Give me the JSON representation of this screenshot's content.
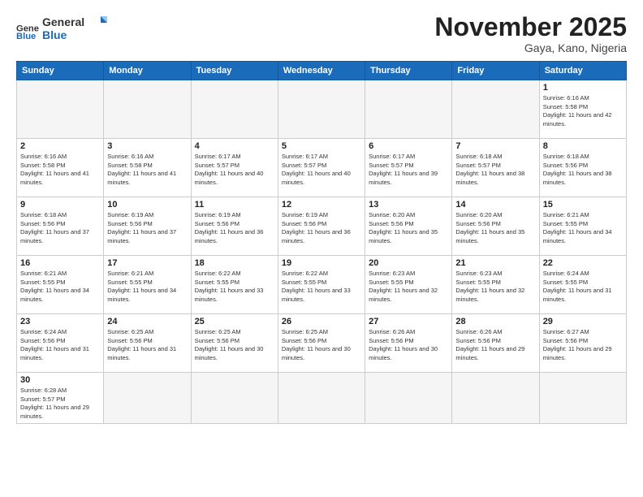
{
  "logo": {
    "text_general": "General",
    "text_blue": "Blue"
  },
  "title": "November 2025",
  "location": "Gaya, Kano, Nigeria",
  "weekdays": [
    "Sunday",
    "Monday",
    "Tuesday",
    "Wednesday",
    "Thursday",
    "Friday",
    "Saturday"
  ],
  "weeks": [
    [
      {
        "day": "",
        "empty": true
      },
      {
        "day": "",
        "empty": true
      },
      {
        "day": "",
        "empty": true
      },
      {
        "day": "",
        "empty": true
      },
      {
        "day": "",
        "empty": true
      },
      {
        "day": "",
        "empty": true
      },
      {
        "day": "1",
        "sunrise": "6:16 AM",
        "sunset": "5:58 PM",
        "daylight": "11 hours and 42 minutes."
      }
    ],
    [
      {
        "day": "2",
        "sunrise": "6:16 AM",
        "sunset": "5:58 PM",
        "daylight": "11 hours and 41 minutes."
      },
      {
        "day": "3",
        "sunrise": "6:16 AM",
        "sunset": "5:58 PM",
        "daylight": "11 hours and 41 minutes."
      },
      {
        "day": "4",
        "sunrise": "6:17 AM",
        "sunset": "5:57 PM",
        "daylight": "11 hours and 40 minutes."
      },
      {
        "day": "5",
        "sunrise": "6:17 AM",
        "sunset": "5:57 PM",
        "daylight": "11 hours and 40 minutes."
      },
      {
        "day": "6",
        "sunrise": "6:17 AM",
        "sunset": "5:57 PM",
        "daylight": "11 hours and 39 minutes."
      },
      {
        "day": "7",
        "sunrise": "6:18 AM",
        "sunset": "5:57 PM",
        "daylight": "11 hours and 38 minutes."
      },
      {
        "day": "8",
        "sunrise": "6:18 AM",
        "sunset": "5:56 PM",
        "daylight": "11 hours and 38 minutes."
      }
    ],
    [
      {
        "day": "9",
        "sunrise": "6:18 AM",
        "sunset": "5:56 PM",
        "daylight": "11 hours and 37 minutes."
      },
      {
        "day": "10",
        "sunrise": "6:19 AM",
        "sunset": "5:56 PM",
        "daylight": "11 hours and 37 minutes."
      },
      {
        "day": "11",
        "sunrise": "6:19 AM",
        "sunset": "5:56 PM",
        "daylight": "11 hours and 36 minutes."
      },
      {
        "day": "12",
        "sunrise": "6:19 AM",
        "sunset": "5:56 PM",
        "daylight": "11 hours and 36 minutes."
      },
      {
        "day": "13",
        "sunrise": "6:20 AM",
        "sunset": "5:56 PM",
        "daylight": "11 hours and 35 minutes."
      },
      {
        "day": "14",
        "sunrise": "6:20 AM",
        "sunset": "5:56 PM",
        "daylight": "11 hours and 35 minutes."
      },
      {
        "day": "15",
        "sunrise": "6:21 AM",
        "sunset": "5:55 PM",
        "daylight": "11 hours and 34 minutes."
      }
    ],
    [
      {
        "day": "16",
        "sunrise": "6:21 AM",
        "sunset": "5:55 PM",
        "daylight": "11 hours and 34 minutes."
      },
      {
        "day": "17",
        "sunrise": "6:21 AM",
        "sunset": "5:55 PM",
        "daylight": "11 hours and 34 minutes."
      },
      {
        "day": "18",
        "sunrise": "6:22 AM",
        "sunset": "5:55 PM",
        "daylight": "11 hours and 33 minutes."
      },
      {
        "day": "19",
        "sunrise": "6:22 AM",
        "sunset": "5:55 PM",
        "daylight": "11 hours and 33 minutes."
      },
      {
        "day": "20",
        "sunrise": "6:23 AM",
        "sunset": "5:55 PM",
        "daylight": "11 hours and 32 minutes."
      },
      {
        "day": "21",
        "sunrise": "6:23 AM",
        "sunset": "5:55 PM",
        "daylight": "11 hours and 32 minutes."
      },
      {
        "day": "22",
        "sunrise": "6:24 AM",
        "sunset": "5:55 PM",
        "daylight": "11 hours and 31 minutes."
      }
    ],
    [
      {
        "day": "23",
        "sunrise": "6:24 AM",
        "sunset": "5:56 PM",
        "daylight": "11 hours and 31 minutes."
      },
      {
        "day": "24",
        "sunrise": "6:25 AM",
        "sunset": "5:56 PM",
        "daylight": "11 hours and 31 minutes."
      },
      {
        "day": "25",
        "sunrise": "6:25 AM",
        "sunset": "5:56 PM",
        "daylight": "11 hours and 30 minutes."
      },
      {
        "day": "26",
        "sunrise": "6:25 AM",
        "sunset": "5:56 PM",
        "daylight": "11 hours and 30 minutes."
      },
      {
        "day": "27",
        "sunrise": "6:26 AM",
        "sunset": "5:56 PM",
        "daylight": "11 hours and 30 minutes."
      },
      {
        "day": "28",
        "sunrise": "6:26 AM",
        "sunset": "5:56 PM",
        "daylight": "11 hours and 29 minutes."
      },
      {
        "day": "29",
        "sunrise": "6:27 AM",
        "sunset": "5:56 PM",
        "daylight": "11 hours and 29 minutes."
      }
    ],
    [
      {
        "day": "30",
        "sunrise": "6:28 AM",
        "sunset": "5:57 PM",
        "daylight": "11 hours and 29 minutes."
      },
      {
        "day": "",
        "empty": true
      },
      {
        "day": "",
        "empty": true
      },
      {
        "day": "",
        "empty": true
      },
      {
        "day": "",
        "empty": true
      },
      {
        "day": "",
        "empty": true
      },
      {
        "day": "",
        "empty": true
      }
    ]
  ]
}
